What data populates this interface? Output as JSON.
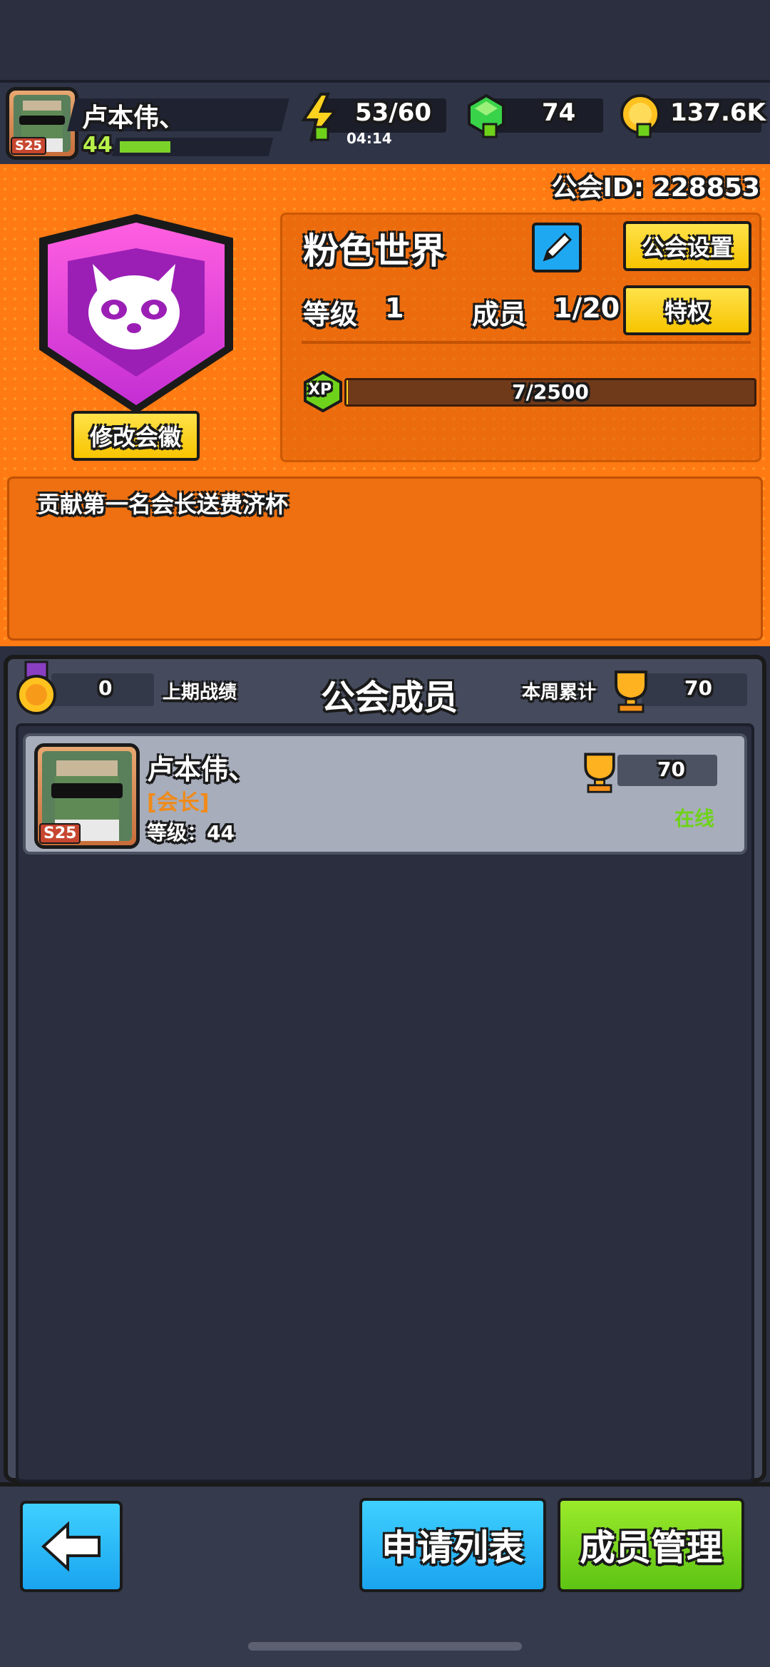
{
  "player": {
    "name": "卢本伟、",
    "level": "44",
    "season_badge": "S25",
    "level_progress": 0.33
  },
  "resources": {
    "energy": "53/60",
    "energy_timer": "04:14",
    "gems": "74",
    "coins": "137.6K"
  },
  "guild": {
    "id_label": "公会ID: 228853",
    "name": "粉色世界",
    "settings_label": "公会设置",
    "level_label": "等级",
    "level_value": "1",
    "members_label": "成员",
    "members_value": "1/20",
    "privilege_label": "特权",
    "xp_icon": "XP",
    "xp_value": "7/2500",
    "xp_progress": 0.0028,
    "change_emblem_label": "修改会徽",
    "notice": "贡献第一名会长送费济杯"
  },
  "members_panel": {
    "title": "公会成员",
    "last_period_value": "0",
    "last_period_label": "上期战绩",
    "week_total_label": "本周累计",
    "week_total_value": "70"
  },
  "members": [
    {
      "name": "卢本伟、",
      "role": "[会长]",
      "level_text": "等级：44",
      "trophies": "70",
      "status": "在线",
      "season_badge": "S25"
    }
  ],
  "bottom": {
    "apply_list_label": "申请列表",
    "manage_label": "成员管理"
  },
  "colors": {
    "orange_bg": "#ff7a12",
    "shield_pink": "#c42ed3",
    "button_yellow": "#f7c400",
    "button_blue": "#1fb8f5",
    "button_green": "#6fd21a",
    "online_green": "#6fd21a",
    "role_orange": "#f08a1a"
  },
  "icons": [
    "energy-icon",
    "gem-icon",
    "coin-icon",
    "pencil-icon",
    "medal-icon",
    "trophy-icon",
    "back-arrow-icon",
    "raccoon-emblem-icon"
  ]
}
